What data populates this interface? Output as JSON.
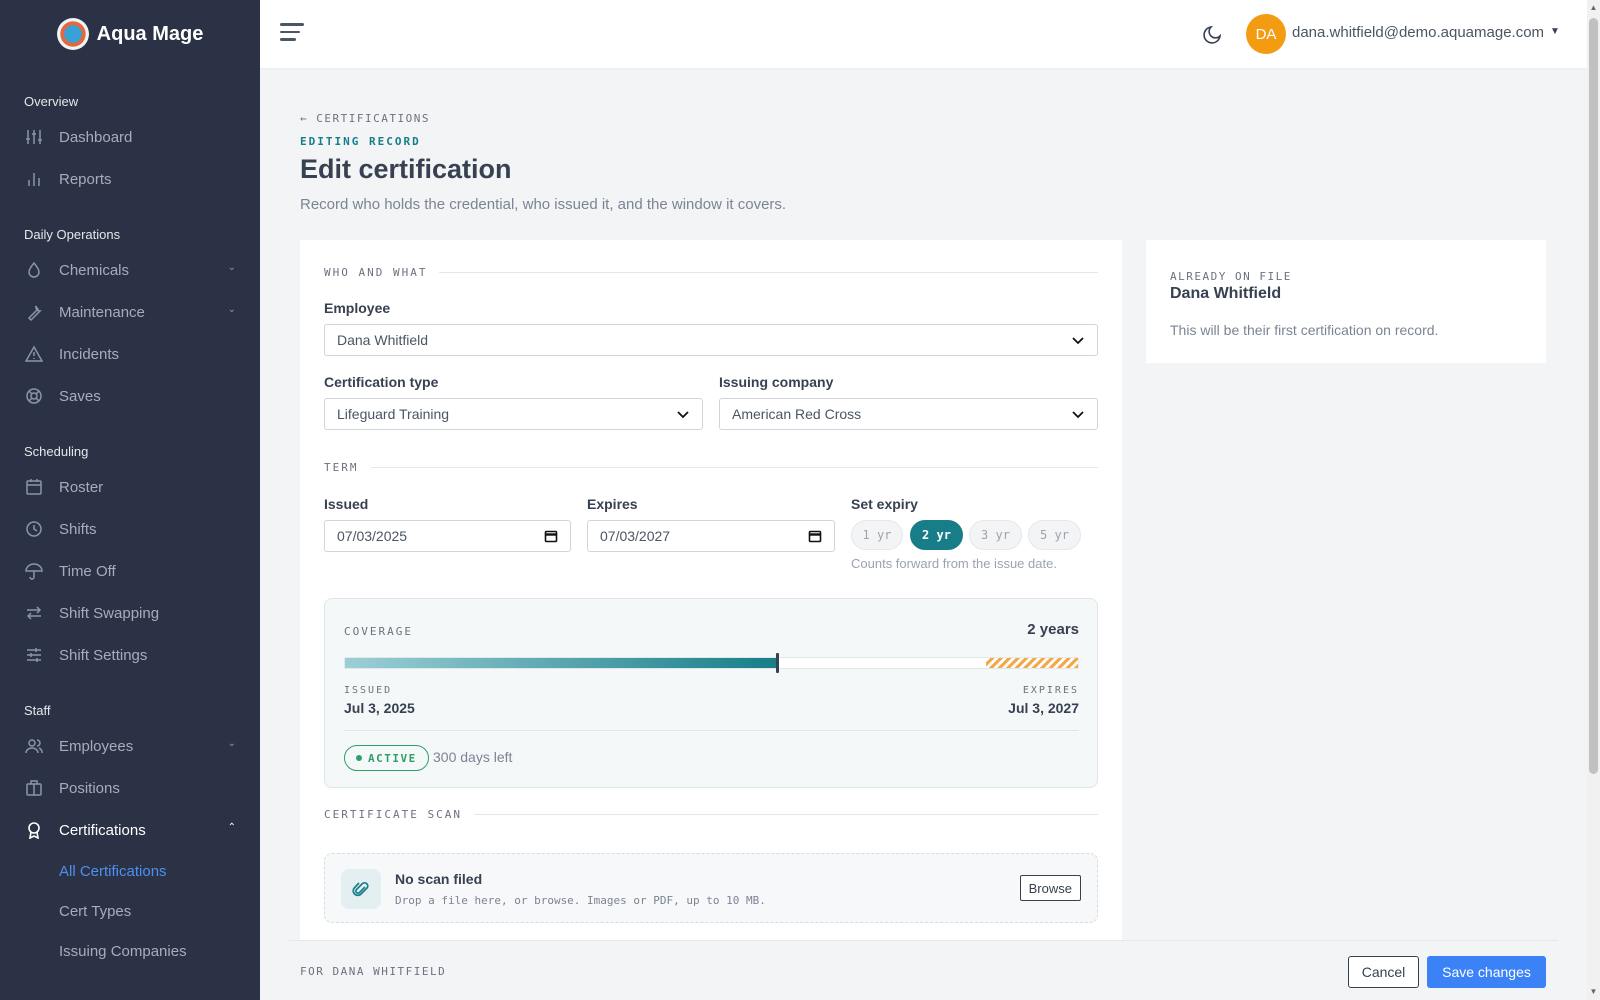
{
  "app": {
    "name": "Aqua Mage"
  },
  "sidebar": {
    "sections": [
      {
        "title": "Overview",
        "items": [
          {
            "label": "Dashboard",
            "icon": "sliders-icon"
          },
          {
            "label": "Reports",
            "icon": "bar-chart-icon"
          }
        ]
      },
      {
        "title": "Daily Operations",
        "items": [
          {
            "label": "Chemicals",
            "icon": "droplet-icon",
            "expandable": true
          },
          {
            "label": "Maintenance",
            "icon": "wrench-icon",
            "expandable": true
          },
          {
            "label": "Incidents",
            "icon": "warning-icon"
          },
          {
            "label": "Saves",
            "icon": "lifebuoy-icon"
          }
        ]
      },
      {
        "title": "Scheduling",
        "items": [
          {
            "label": "Roster",
            "icon": "calendar-icon"
          },
          {
            "label": "Shifts",
            "icon": "clock-icon"
          },
          {
            "label": "Time Off",
            "icon": "umbrella-icon"
          },
          {
            "label": "Shift Swapping",
            "icon": "swap-icon"
          },
          {
            "label": "Shift Settings",
            "icon": "settings-sliders-icon"
          }
        ]
      },
      {
        "title": "Staff",
        "items": [
          {
            "label": "Employees",
            "icon": "users-icon",
            "expandable": true
          },
          {
            "label": "Positions",
            "icon": "building-icon"
          },
          {
            "label": "Certifications",
            "icon": "award-icon",
            "expandable": true,
            "expanded": true,
            "active": true,
            "children": [
              {
                "label": "All Certifications",
                "active": true
              },
              {
                "label": "Cert Types"
              },
              {
                "label": "Issuing Companies"
              }
            ]
          }
        ]
      }
    ]
  },
  "topbar": {
    "avatar_initials": "DA",
    "user_email": "dana.whitfield@demo.aquamage.com",
    "avatar_color": "#f39c12"
  },
  "page": {
    "back_link": "← CERTIFICATIONS",
    "eyebrow": "EDITING RECORD",
    "title": "Edit certification",
    "subtitle": "Record who holds the credential, who issued it, and the window it covers."
  },
  "form": {
    "section_who": "WHO AND WHAT",
    "employee_label": "Employee",
    "employee_value": "Dana Whitfield",
    "cert_type_label": "Certification type",
    "cert_type_value": "Lifeguard Training",
    "issuer_label": "Issuing company",
    "issuer_value": "American Red Cross",
    "section_term": "TERM",
    "issued_label": "Issued",
    "issued_value": "07/03/2025",
    "expires_label": "Expires",
    "expires_value": "07/03/2027",
    "set_expiry_label": "Set expiry",
    "expiry_options": [
      "1 yr",
      "2 yr",
      "3 yr",
      "5 yr"
    ],
    "expiry_selected": "2 yr",
    "expiry_hint": "Counts forward from the issue date."
  },
  "coverage": {
    "label": "COVERAGE",
    "duration": "2 years",
    "issued_caption": "ISSUED",
    "issued_date": "Jul 3, 2025",
    "expires_caption": "EXPIRES",
    "expires_date": "Jul 3, 2027",
    "elapsed_fraction": 0.59,
    "status": "ACTIVE",
    "days_left": "300 days left",
    "accent_color": "#177e89",
    "warning_color": "#f3a94a",
    "status_color": "#2f9e6b"
  },
  "scan": {
    "section_title": "CERTIFICATE SCAN",
    "title": "No scan filed",
    "description": "Drop a file here, or browse. Images or PDF, up to 10 MB.",
    "browse_label": "Browse"
  },
  "side_panel": {
    "eyebrow": "ALREADY ON FILE",
    "name": "Dana Whitfield",
    "note": "This will be their first certification on record."
  },
  "footer": {
    "note": "FOR DANA WHITFIELD",
    "cancel_label": "Cancel",
    "save_label": "Save changes",
    "save_color": "#3b82f6"
  }
}
